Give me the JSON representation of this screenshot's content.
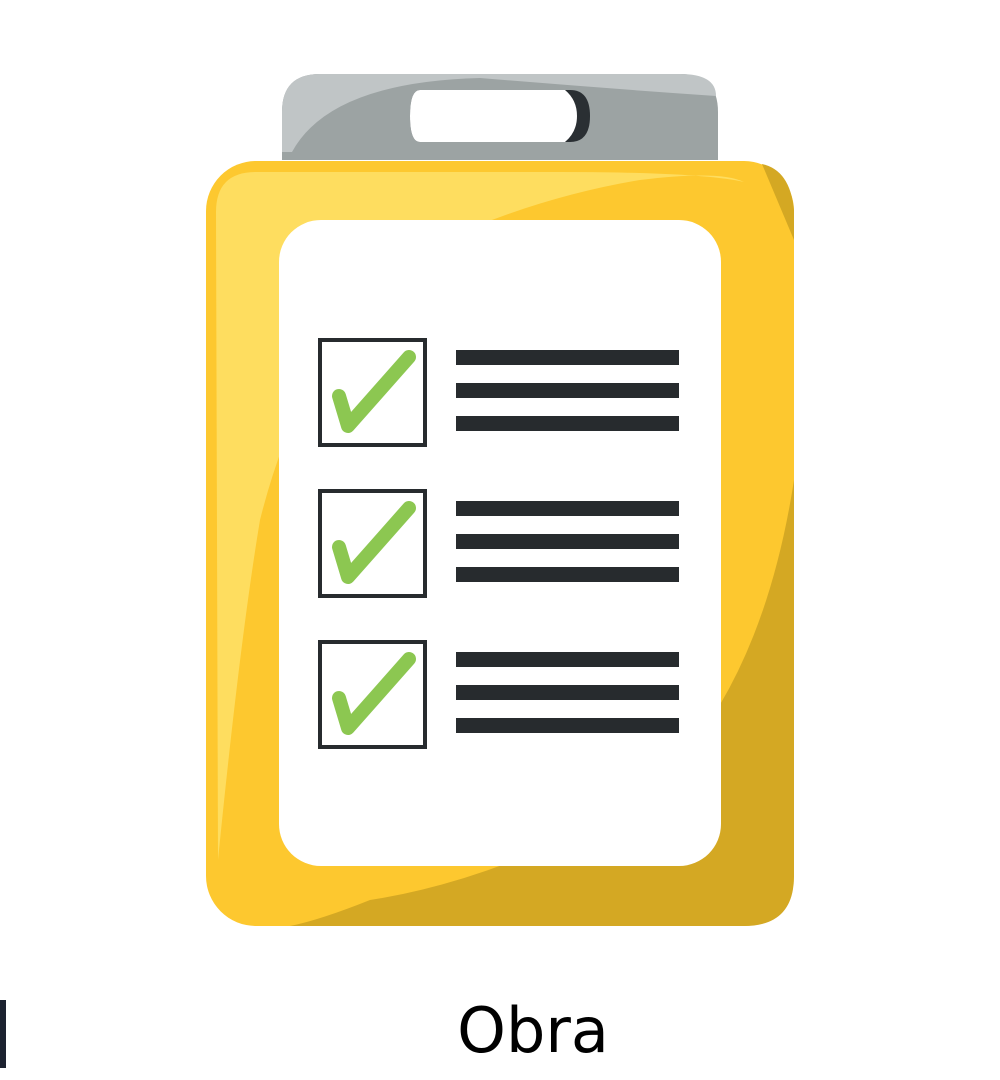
{
  "caption": "Obra",
  "checklist": {
    "items": [
      {
        "checked": true
      },
      {
        "checked": true
      },
      {
        "checked": true
      }
    ]
  },
  "colors": {
    "board": "#fdc82f",
    "board_highlight": "#fedd5f",
    "board_shadow": "#d4a823",
    "clip": "#9ca3a3",
    "clip_highlight": "#c0c5c6",
    "paper": "#ffffff",
    "check": "#8cc751",
    "ink": "#272b2e"
  }
}
